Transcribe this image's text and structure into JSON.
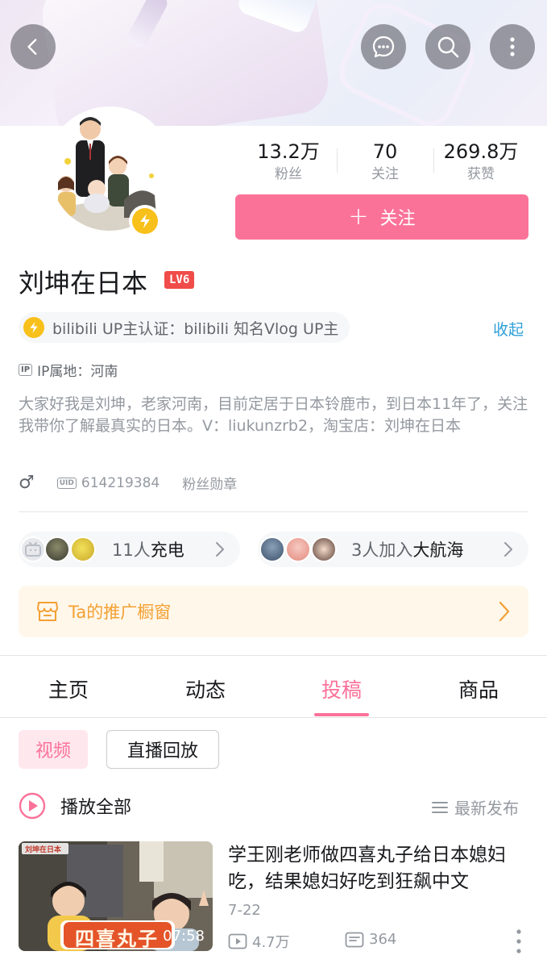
{
  "header": {
    "back_icon": "chevron-left-icon",
    "actions": [
      "message-icon",
      "search-icon",
      "more-vertical-icon"
    ]
  },
  "profile": {
    "stats": [
      {
        "value": "13.2万",
        "label": "粉丝"
      },
      {
        "value": "70",
        "label": "关注"
      },
      {
        "value": "269.8万",
        "label": "获赞"
      }
    ],
    "follow_button": {
      "icon": "+",
      "label": "关注"
    },
    "name": "刘坤在日本",
    "level": "LV6",
    "certification": "bilibili UP主认证：bilibili 知名Vlog UP主",
    "collapse_label": "收起",
    "ip_tag": "IP",
    "ip_location": "IP属地：河南",
    "bio": "大家好我是刘坤，老家河南，目前定居于日本铃鹿市，到日本11年了，关注我带你了解最真实的日本。V：liukunzrb2，淘宝店：刘坤在日本",
    "gender_symbol": "♂",
    "uid_tag": "UID",
    "uid": "614219384",
    "fan_badge": "粉丝勋章"
  },
  "supporters": {
    "charge": {
      "count_text": "11人",
      "action_text": "充电"
    },
    "voyage": {
      "count_text": "3人加入",
      "action_text": "大航海"
    }
  },
  "shop_window": {
    "label": "Ta的推广橱窗"
  },
  "tabs": [
    {
      "label": "主页",
      "active": false
    },
    {
      "label": "动态",
      "active": false
    },
    {
      "label": "投稿",
      "active": true
    },
    {
      "label": "商品",
      "active": false
    }
  ],
  "filters": [
    {
      "label": "视频",
      "active": true
    },
    {
      "label": "直播回放",
      "active": false
    }
  ],
  "list_header": {
    "play_all": "播放全部",
    "sort": "最新发布"
  },
  "videos": [
    {
      "title": "学王刚老师做四喜丸子给日本媳妇吃，结果媳妇好吃到狂飙中文",
      "date": "7-22",
      "views": "4.7万",
      "comments": "364",
      "duration": "07:58",
      "thumb_caption": "四喜丸子",
      "thumb_brand": "刘坤在日本"
    }
  ],
  "colors": {
    "brand_pink": "#fb7299",
    "link_blue": "#2e9fd8",
    "gold": "#f8c01a",
    "level_red": "#f04c49",
    "shop_orange": "#f3a034"
  }
}
